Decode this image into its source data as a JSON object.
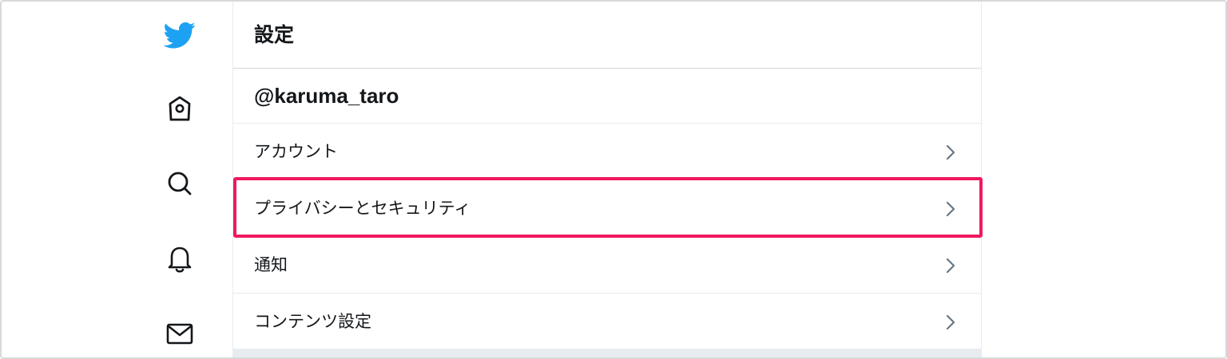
{
  "nav": {
    "icons": [
      "twitter-bird-icon",
      "home-icon",
      "search-icon",
      "bell-icon",
      "mail-icon"
    ],
    "brand_color": "#1da1f2"
  },
  "settings": {
    "title": "設定",
    "account": "@karuma_taro",
    "items": [
      {
        "label": "アカウント"
      },
      {
        "label": "プライバシーとセキュリティ",
        "highlighted": true
      },
      {
        "label": "通知"
      },
      {
        "label": "コンテンツ設定"
      }
    ]
  },
  "highlight_color": "#f0195e"
}
